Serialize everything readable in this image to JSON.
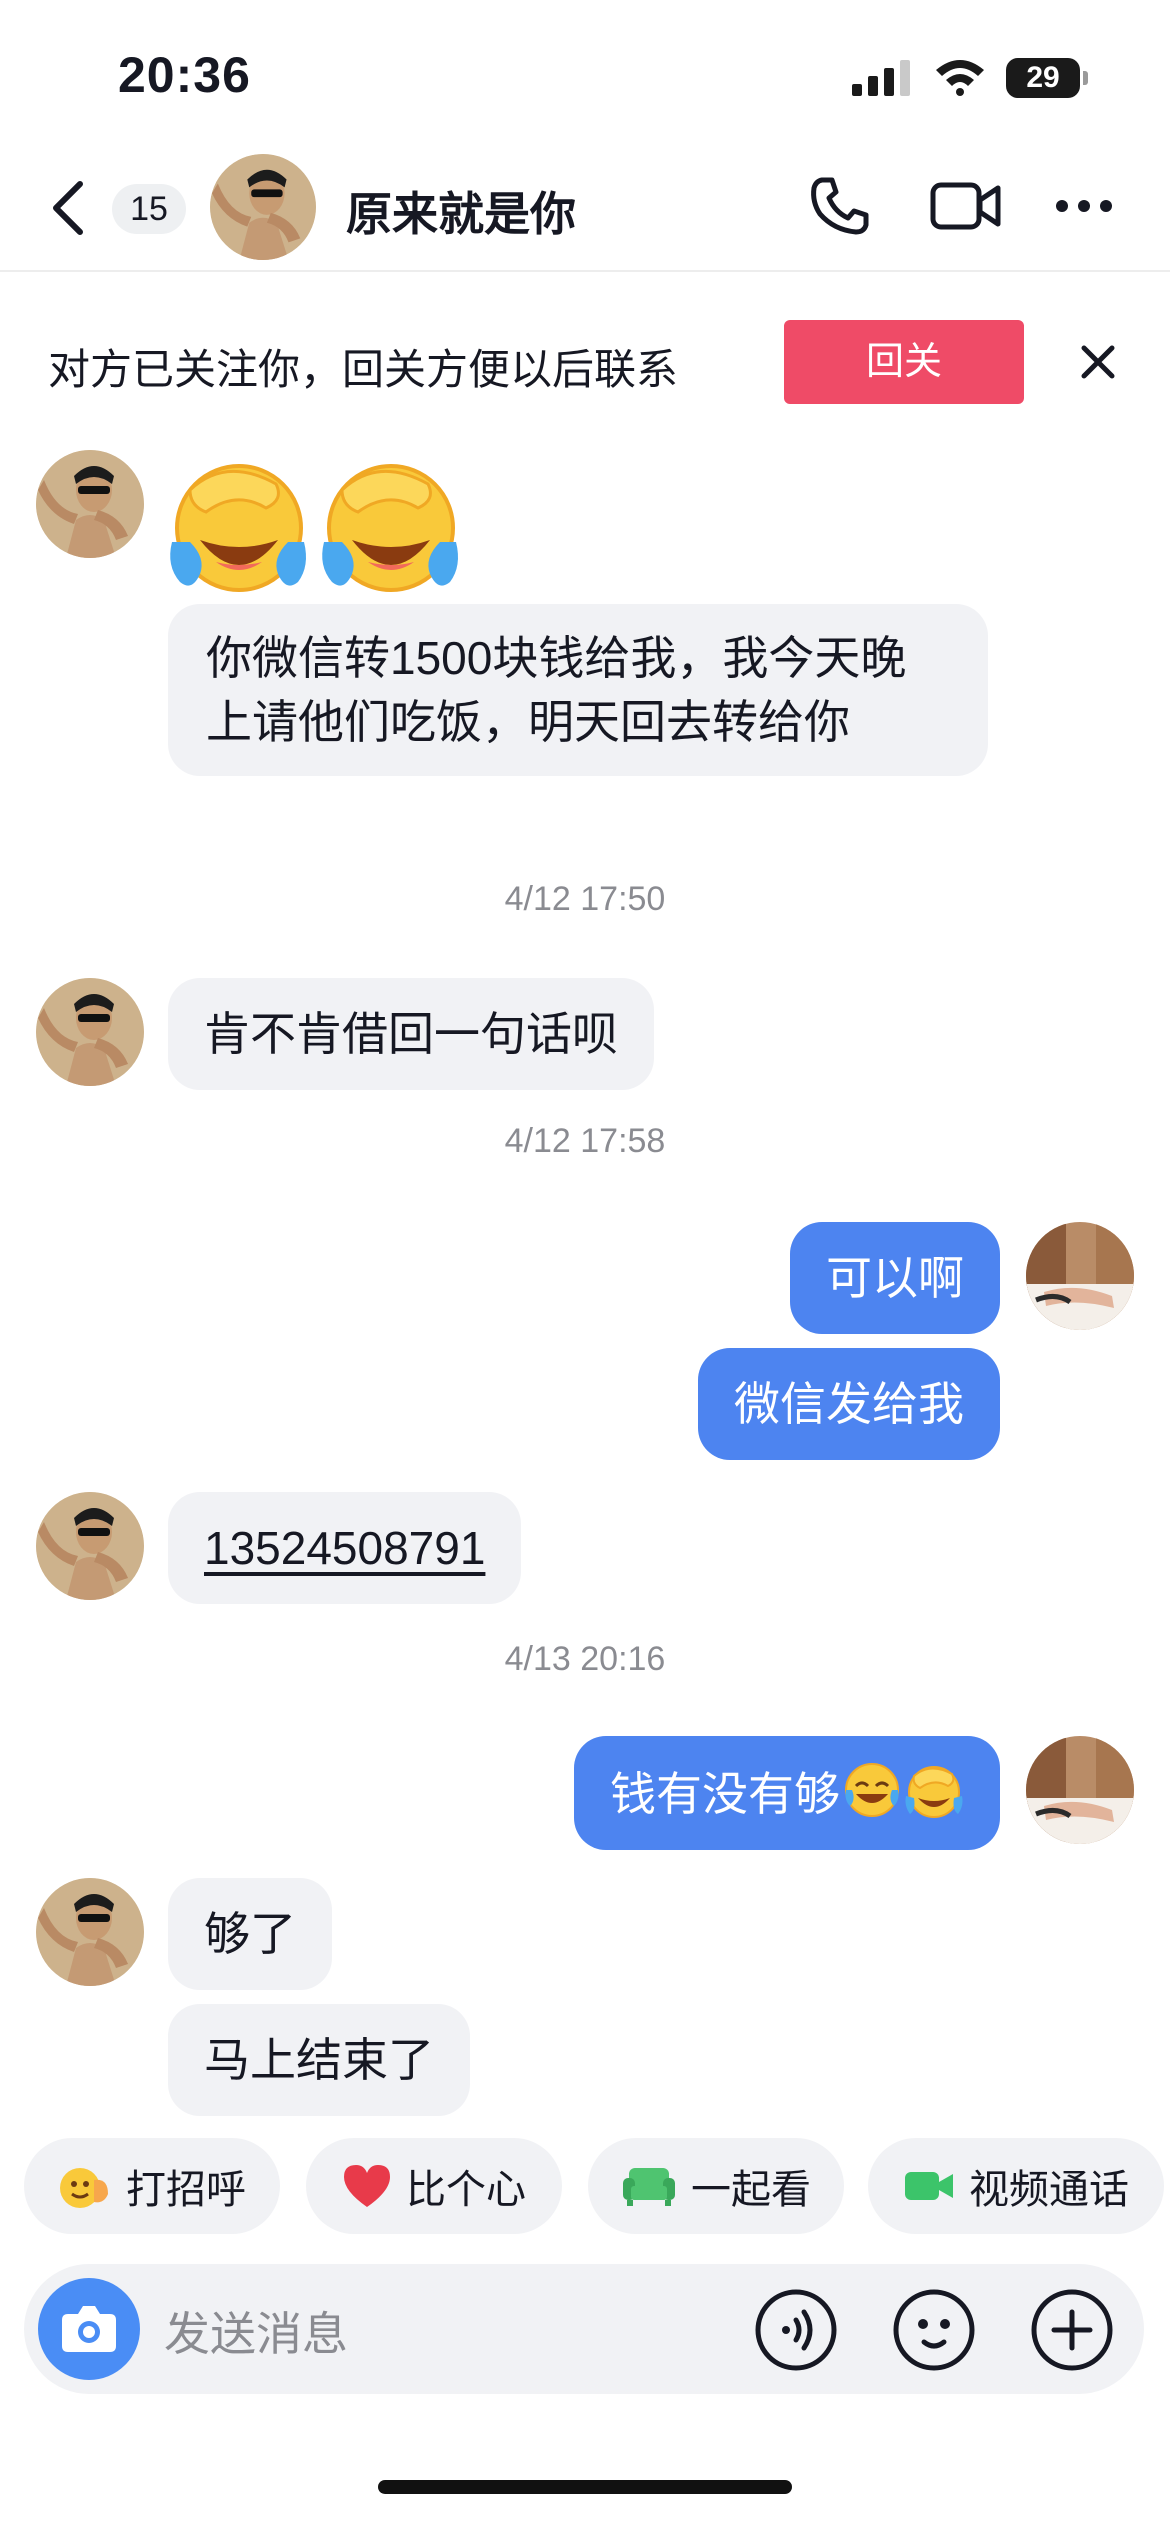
{
  "status_bar": {
    "time": "20:36",
    "battery": "29"
  },
  "header": {
    "unread_count": "15",
    "contact_name": "原来就是你"
  },
  "follow_banner": {
    "text": "对方已关注你，回关方便以后联系",
    "button_label": "回关"
  },
  "messages": [
    {
      "side": "in",
      "type": "emoji",
      "emojis": [
        "facepalm-cry-emoji",
        "facepalm-cry-emoji"
      ]
    },
    {
      "side": "in",
      "type": "text",
      "text": "你微信转1500块钱给我，我今天晚上请他们吃饭，明天回去转给你"
    },
    {
      "type": "timestamp",
      "text": "4/12 17:50"
    },
    {
      "side": "in",
      "type": "text",
      "text": "肯不肯借回一句话呗"
    },
    {
      "type": "timestamp",
      "text": "4/12 17:58"
    },
    {
      "side": "out",
      "type": "text",
      "text": "可以啊"
    },
    {
      "side": "out",
      "type": "text",
      "text": "微信发给我"
    },
    {
      "side": "in",
      "type": "text",
      "text": "13524508791"
    },
    {
      "type": "timestamp",
      "text": "4/13 20:16"
    },
    {
      "side": "out",
      "type": "text",
      "text": "钱有没有够",
      "emojis": [
        "laugh-tears-emoji",
        "facepalm-cry-emoji"
      ]
    },
    {
      "side": "in",
      "type": "text",
      "text": "够了"
    },
    {
      "side": "in",
      "type": "text",
      "text": "马上结束了"
    }
  ],
  "quick_actions": [
    {
      "label": "打招呼",
      "icon": "wave-hand-icon"
    },
    {
      "label": "比个心",
      "icon": "heart-icon"
    },
    {
      "label": "一起看",
      "icon": "sofa-icon"
    },
    {
      "label": "视频通话",
      "icon": "video-call-icon"
    }
  ],
  "input": {
    "placeholder": "发送消息"
  },
  "colors": {
    "accent_red": "#ef4b67",
    "outgoing_bubble": "#4d84f0",
    "incoming_bubble": "#f1f2f5",
    "camera_blue": "#4a8df5"
  }
}
